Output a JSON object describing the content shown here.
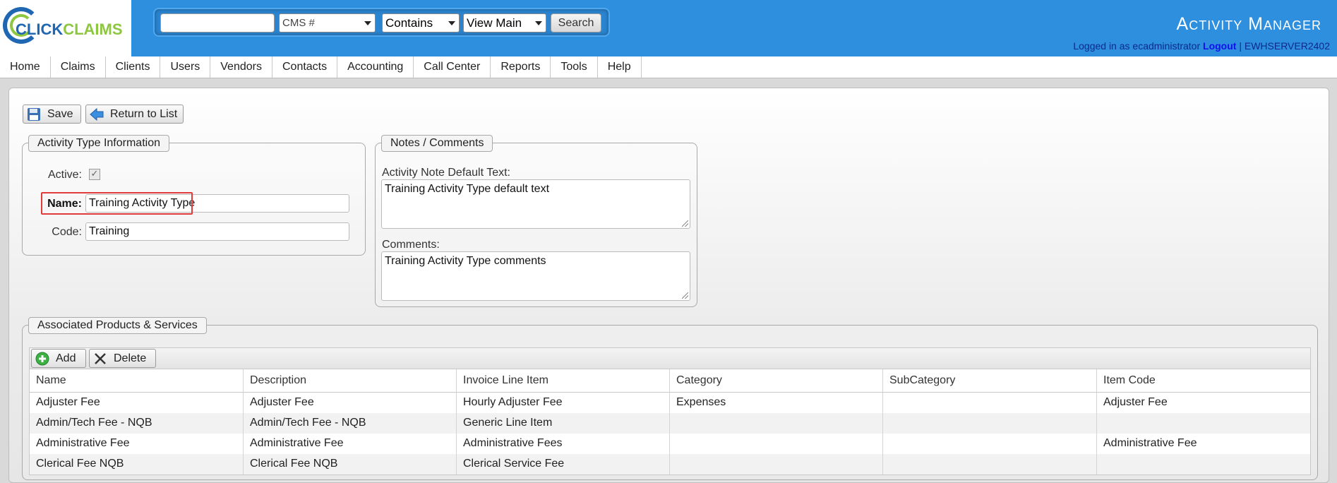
{
  "header": {
    "logo": {
      "part1": "CLICK",
      "part2": "CLAIMS"
    },
    "app_title": "Activity Manager",
    "search": {
      "input_value": "",
      "field_select": "CMS #",
      "match_select": "Contains",
      "view_select": "View Main",
      "button": "Search"
    },
    "login": {
      "prefix": "Logged in as ecadministrator",
      "logout": "Logout",
      "separator": "|",
      "server": "EWHSERVER2402"
    }
  },
  "nav": [
    "Home",
    "Claims",
    "Clients",
    "Users",
    "Vendors",
    "Contacts",
    "Accounting",
    "Call Center",
    "Reports",
    "Tools",
    "Help"
  ],
  "toolbar": {
    "save": "Save",
    "return": "Return to List"
  },
  "activity_type": {
    "legend": "Activity Type Information",
    "active_label": "Active:",
    "active_checked": "✓",
    "name_label": "Name:",
    "name_value": "Training Activity Type",
    "code_label": "Code:",
    "code_value": "Training"
  },
  "notes": {
    "legend": "Notes / Comments",
    "default_text_label": "Activity Note Default Text:",
    "default_text_value": "Training Activity Type default text",
    "comments_label": "Comments:",
    "comments_value": "Training Activity Type comments"
  },
  "products": {
    "legend": "Associated Products & Services",
    "add": "Add",
    "delete": "Delete",
    "columns": [
      "Name",
      "Description",
      "Invoice Line Item",
      "Category",
      "SubCategory",
      "Item Code"
    ],
    "rows": [
      [
        "Adjuster Fee",
        "Adjuster Fee",
        "Hourly Adjuster Fee",
        "Expenses",
        "",
        "Adjuster Fee"
      ],
      [
        "Admin/Tech Fee - NQB",
        "Admin/Tech Fee - NQB",
        "Generic Line Item",
        "",
        "",
        ""
      ],
      [
        "Administrative Fee",
        "Administrative Fee",
        "Administrative Fees",
        "",
        "",
        "Administrative Fee"
      ],
      [
        "Clerical Fee NQB",
        "Clerical Fee NQB",
        "Clerical Service Fee",
        "",
        "",
        ""
      ]
    ]
  }
}
